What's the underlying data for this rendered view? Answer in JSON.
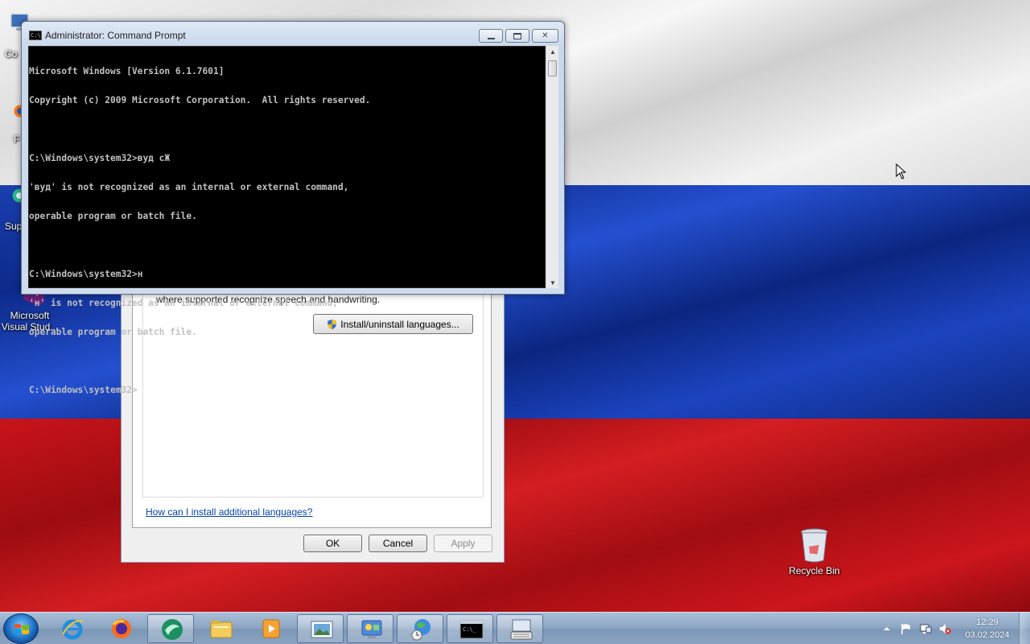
{
  "desktop": {
    "icons": [
      {
        "name": "computer-icon",
        "label": "Co"
      },
      {
        "name": "firefox-desktop-icon",
        "label": "F"
      },
      {
        "name": "support-icon",
        "label": "Sup"
      },
      {
        "name": "visual-studio-icon",
        "label_line1": "Microsoft",
        "label_line2": "Visual Stud..."
      }
    ],
    "recycle_bin": {
      "label": "Recycle Bin"
    }
  },
  "cmd": {
    "title": "Administrator: Command Prompt",
    "lines": [
      "Microsoft Windows [Version 6.1.7601]",
      "Copyright (c) 2009 Microsoft Corporation.  All rights reserved.",
      "",
      "C:\\Windows\\system32>вуд сЖ",
      "'вуд' is not recognized as an internal or external command,",
      "operable program or batch file.",
      "",
      "C:\\Windows\\system32>н",
      "'н' is not recognized as an internal or external command,",
      "operable program or batch file.",
      "",
      "C:\\Windows\\system32>"
    ],
    "buttons": {
      "minimize": "▭",
      "maximize": "▢",
      "close": "✕"
    }
  },
  "language_dialog": {
    "description": "where supported recognize speech and handwriting.",
    "install_button": "Install/uninstall languages...",
    "help_link": "How can I install additional languages?",
    "ok": "OK",
    "cancel": "Cancel",
    "apply": "Apply"
  },
  "taskbar": {
    "items": [
      "internet-explorer",
      "firefox",
      "app-green",
      "file-explorer",
      "media-player",
      "picture-viewer",
      "control-panel",
      "network-clock",
      "command-prompt",
      "keyboard-settings"
    ],
    "clock_time": "12:29",
    "clock_date": "03.02.2024"
  },
  "colors": {
    "flag_white": "#f4f4f4",
    "flag_blue": "#1a3fb0",
    "flag_red": "#c8141a",
    "console_bg": "#000000",
    "console_text": "#c0c0c0",
    "link": "#0645ad"
  }
}
